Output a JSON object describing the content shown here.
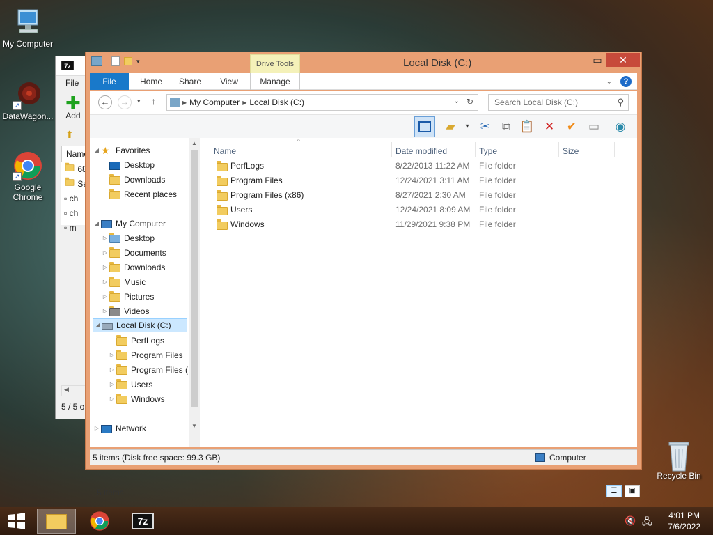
{
  "desktop": {
    "icons": [
      {
        "label": "My Computer",
        "icon": "computer-icon"
      },
      {
        "label": "DataWagon...",
        "icon": "datawagon-icon"
      },
      {
        "label": "Google Chrome",
        "icon": "chrome-icon"
      },
      {
        "label": "Recycle Bin",
        "icon": "recycle-bin-icon"
      }
    ]
  },
  "sevenzip": {
    "logo": "7z",
    "file_menu": "File",
    "add_label": "Add",
    "col_name": "Name",
    "rows": [
      "68",
      "Se",
      "ch",
      "ch",
      "m"
    ],
    "status": "5 / 5 o"
  },
  "explorer": {
    "title": "Local Disk (C:)",
    "context_tab": "Drive Tools",
    "tabs": [
      "File",
      "Home",
      "Share",
      "View",
      "Manage"
    ],
    "address": [
      "My Computer",
      "Local Disk (C:)"
    ],
    "search_placeholder": "Search Local Disk (C:)",
    "columns": [
      "Name",
      "Date modified",
      "Type",
      "Size"
    ],
    "files": [
      {
        "name": "PerfLogs",
        "date": "8/22/2013 11:22 AM",
        "type": "File folder"
      },
      {
        "name": "Program Files",
        "date": "12/24/2021 3:11 AM",
        "type": "File folder"
      },
      {
        "name": "Program Files (x86)",
        "date": "8/27/2021 2:30 AM",
        "type": "File folder"
      },
      {
        "name": "Users",
        "date": "12/24/2021 8:09 AM",
        "type": "File folder"
      },
      {
        "name": "Windows",
        "date": "11/29/2021 9:38 PM",
        "type": "File folder"
      }
    ],
    "tree": {
      "favorites": "Favorites",
      "fav_items": [
        "Desktop",
        "Downloads",
        "Recent places"
      ],
      "computer": "My Computer",
      "comp_items": [
        "Desktop",
        "Documents",
        "Downloads",
        "Music",
        "Pictures",
        "Videos"
      ],
      "local_disk": "Local Disk (C:)",
      "disk_items": [
        "PerfLogs",
        "Program Files",
        "Program Files (",
        "Users",
        "Windows"
      ],
      "network": "Network"
    },
    "items_count": "5 items",
    "status_left": "5 items (Disk free space: 99.3 GB)",
    "status_right": "Computer"
  },
  "taskbar": {
    "time": "4:01 PM",
    "date": "7/6/2022",
    "sevenz_label": "7z"
  }
}
